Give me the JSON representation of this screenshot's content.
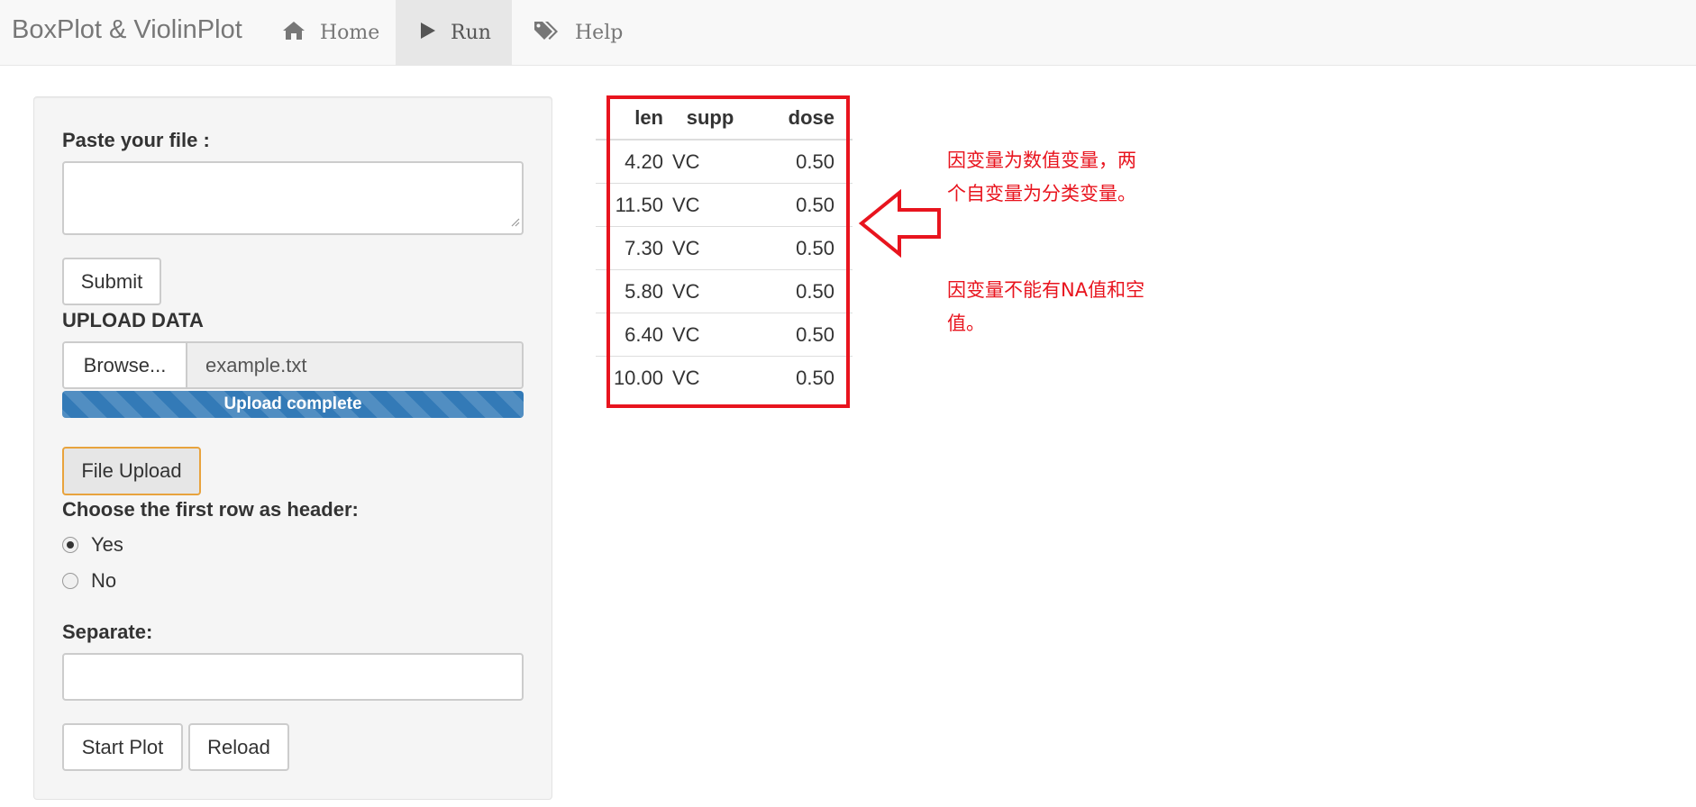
{
  "navbar": {
    "brand": "BoxPlot & ViolinPlot",
    "items": [
      {
        "label": "Home",
        "icon": "home-icon",
        "active": false
      },
      {
        "label": "Run",
        "icon": "play-icon",
        "active": true
      },
      {
        "label": "Help",
        "icon": "tags-icon",
        "active": false
      }
    ]
  },
  "sidebar": {
    "paste_label": "Paste your file :",
    "paste_value": "",
    "submit_label": "Submit",
    "upload_label": "UPLOAD DATA",
    "browse_label": "Browse...",
    "file_name": "example.txt",
    "progress_text": "Upload complete",
    "progress_fraction": 1.0,
    "file_upload_label": "File Upload",
    "header_question": "Choose the first row as header:",
    "header_options": [
      "Yes",
      "No"
    ],
    "header_selected": "Yes",
    "separate_label": "Separate:",
    "separate_value": "",
    "start_plot_label": "Start Plot",
    "reload_label": "Reload"
  },
  "table": {
    "headers": [
      "len",
      "supp",
      "dose"
    ],
    "rows": [
      [
        "4.20",
        "VC",
        "0.50"
      ],
      [
        "11.50",
        "VC",
        "0.50"
      ],
      [
        "7.30",
        "VC",
        "0.50"
      ],
      [
        "5.80",
        "VC",
        "0.50"
      ],
      [
        "6.40",
        "VC",
        "0.50"
      ],
      [
        "10.00",
        "VC",
        "0.50"
      ]
    ]
  },
  "annotations": {
    "note1": "因变量为数值变量，两个自变量为分类变量。",
    "note2": "因变量不能有NA值和空值。",
    "color": "#e8141e"
  },
  "colors": {
    "progress": "#337ab7",
    "navbar_bg": "#f8f8f8",
    "active_tab_bg": "#e7e7e7",
    "focus_border": "#e8a33d"
  }
}
